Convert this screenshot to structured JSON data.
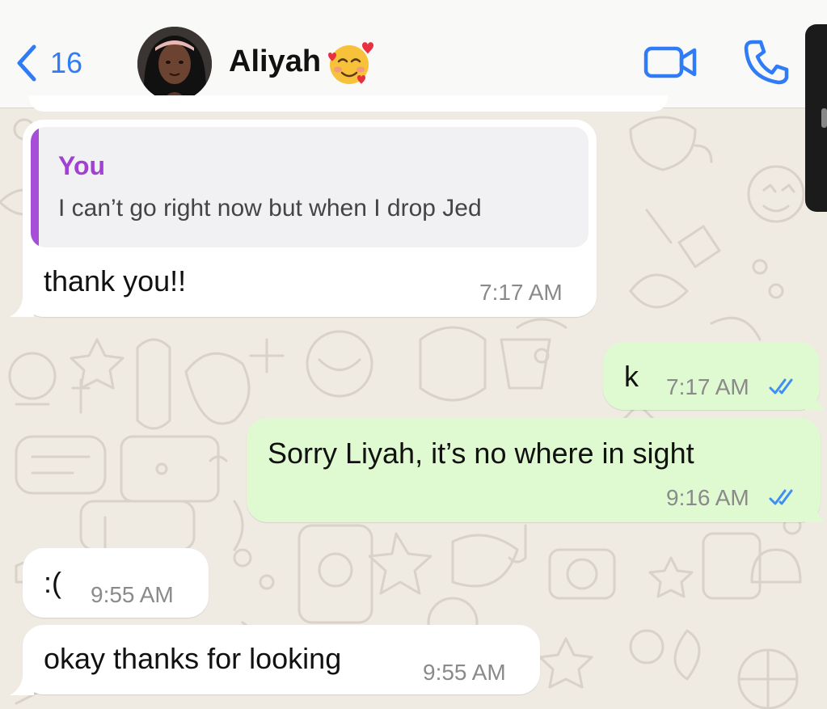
{
  "header": {
    "back_count": "16",
    "contact_name": "Aliyah"
  },
  "messages": [
    {
      "direction": "incoming",
      "quote": {
        "author": "You",
        "text": "I can’t go right now but when I drop Jed"
      },
      "text": "thank you!!",
      "time": "7:17 AM"
    },
    {
      "direction": "outgoing",
      "text": "k",
      "time": "7:17 AM",
      "read": true
    },
    {
      "direction": "outgoing",
      "text": "Sorry Liyah, it’s no where in sight",
      "time": "9:16 AM",
      "read": true
    },
    {
      "direction": "incoming",
      "text": ":(",
      "time": "9:55 AM"
    },
    {
      "direction": "incoming",
      "text": "okay thanks for looking",
      "time": "9:55 AM"
    }
  ],
  "icons": {
    "back": "chevron-left-icon",
    "video": "video-camera-icon",
    "call": "phone-icon",
    "emoji": "smiling-face-with-hearts-icon",
    "read_receipt": "double-check-icon"
  },
  "colors": {
    "accent_blue": "#2f7cf6",
    "outgoing_bubble": "#dffad0",
    "incoming_bubble": "#ffffff",
    "quote_author": "#a041d2",
    "chat_background": "#efeae2"
  }
}
